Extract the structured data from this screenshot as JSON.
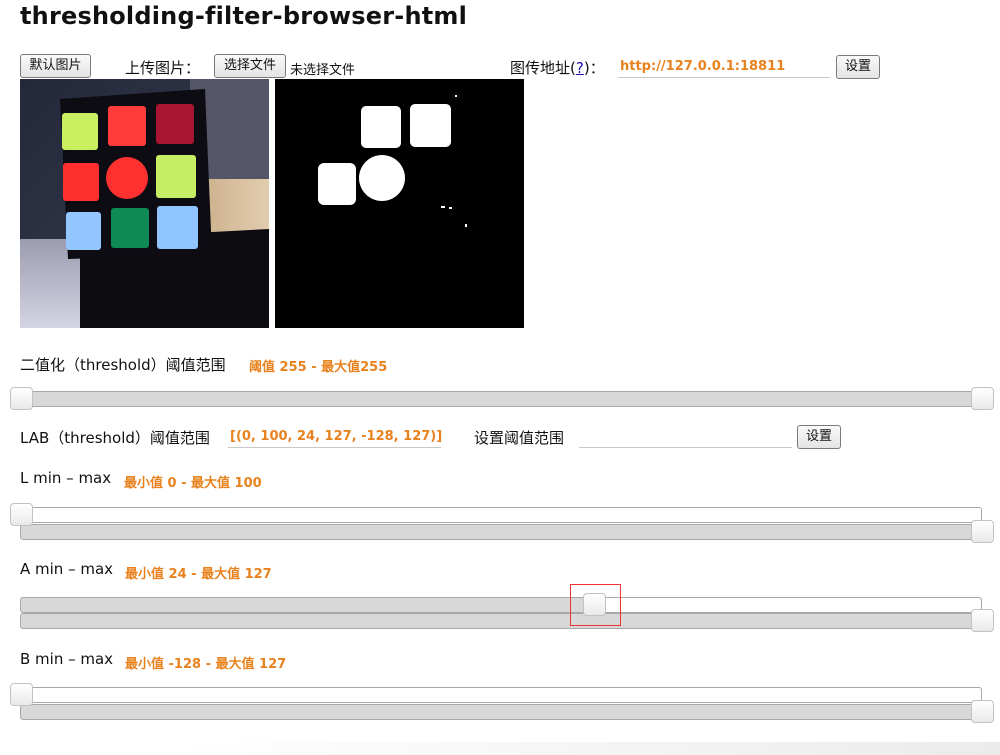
{
  "page": {
    "title": "thresholding-filter-browser-html"
  },
  "toolbar": {
    "default_image_button": "默认图片",
    "upload_label": "上传图片：",
    "choose_file_button": "选择文件",
    "no_file_text": "未选择文件",
    "stream_address_label": "图传地址",
    "help_link": "?",
    "stream_address_value": "http://127.0.0.1:18811",
    "set_button": "设置"
  },
  "threshold": {
    "label": "二值化（threshold）阈值范围",
    "value_text": "阈值 255 - 最大值255",
    "min": 0,
    "max": 255,
    "lower": 0,
    "upper": 255
  },
  "lab": {
    "label": "LAB（threshold）阈值范围",
    "value": "[(0, 100, 24, 127, -128, 127)]",
    "set_range_label": "设置阈值范围",
    "set_range_value": "",
    "set_button": "设置"
  },
  "sliders": {
    "l": {
      "label": "L min – max",
      "value_text": "最小值 0 - 最大值 100",
      "range": [
        0,
        100
      ],
      "min": 0,
      "max": 100
    },
    "a": {
      "label": "A min – max",
      "value_text": "最小值 24 - 最大值 127",
      "range": [
        -128,
        127
      ],
      "min": 24,
      "max": 127
    },
    "b": {
      "label": "B min – max",
      "value_text": "最小值 -128 - 最大值 127",
      "range": [
        -128,
        127
      ],
      "min": -128,
      "max": 127
    }
  },
  "colors": {
    "accent": "#e8821e",
    "cube_yellow_green": "#c9f060",
    "cube_red": "#ff3b3b",
    "cube_dark_red": "#a81530",
    "cube_blue": "#8fc4ff",
    "cube_green": "#0d8a55",
    "highlight": "#e33333"
  }
}
